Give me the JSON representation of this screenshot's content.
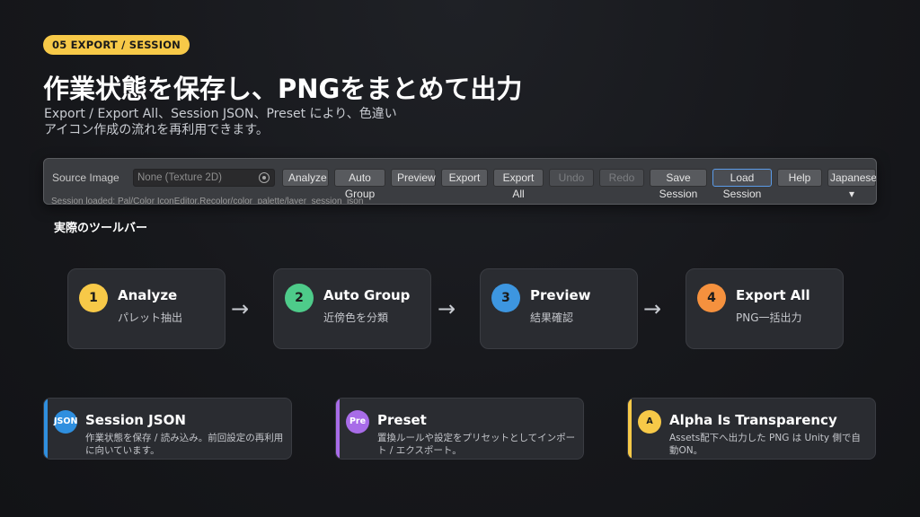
{
  "badge": "05  EXPORT / SESSION",
  "title": "作業状態を保存し、PNGをまとめて出力",
  "subtitle_line1": "Export / Export All、Session JSON、Preset により、色違い",
  "subtitle_line2": "アイコン作成の流れを再利用できます。",
  "toolbar": {
    "source_label": "Source Image",
    "source_value": "None (Texture 2D)",
    "buttons": {
      "analyze": "Analyze",
      "auto_group": "Auto Group",
      "preview": "Preview",
      "export": "Export",
      "export_all": "Export All",
      "undo": "Undo",
      "redo": "Redo",
      "save_session": "Save Session",
      "load_session": "Load Session",
      "help": "Help",
      "language": "Japanese ▾"
    },
    "status": "Session loaded: Pal/Color IconEditor.Recolor/color_palette/layer_session_json",
    "caption": "実際のツールバー"
  },
  "steps": [
    {
      "num": "1",
      "name": "Analyze",
      "desc": "パレット抽出",
      "color": "#f7c948"
    },
    {
      "num": "2",
      "name": "Auto Group",
      "desc": "近傍色を分類",
      "color": "#4ecb8a"
    },
    {
      "num": "3",
      "name": "Preview",
      "desc": "結果確認",
      "color": "#3d96e0"
    },
    {
      "num": "4",
      "name": "Export All",
      "desc": "PNG一括出力",
      "color": "#f5913e"
    }
  ],
  "arrow": "→",
  "cards": [
    {
      "icon": "JSON",
      "title": "Session JSON",
      "desc": "作業状態を保存 / 読み込み。前回設定の再利用に向いています。",
      "color": "#2f8fdf"
    },
    {
      "icon": "Pre",
      "title": "Preset",
      "desc": "置換ルールや設定をプリセットとしてインポート / エクスポート。",
      "color": "#a86ce8"
    },
    {
      "icon": "A",
      "title": "Alpha Is Transparency",
      "desc": "Assets配下へ出力した PNG は Unity 側で自動ON。",
      "color": "#f7c948"
    }
  ]
}
